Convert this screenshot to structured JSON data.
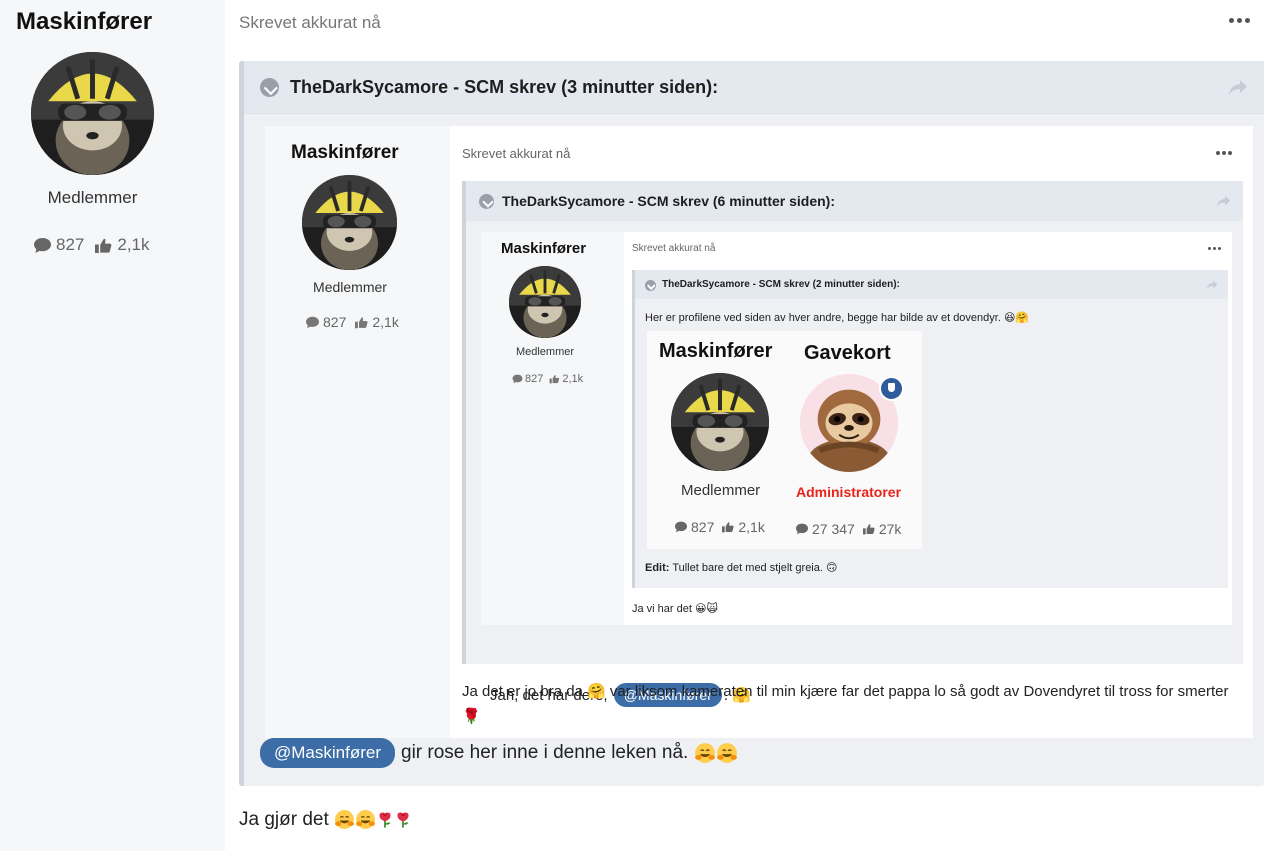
{
  "author": {
    "name": "Maskinfører",
    "group": "Medlemmer",
    "posts": "827",
    "reactions": "2,1k"
  },
  "post": {
    "date": "Skrevet akkurat nå",
    "body": "Ja gjør det",
    "body_emojis": [
      "hugging-face",
      "hugging-face",
      "rose",
      "rose"
    ]
  },
  "quote1": {
    "title": "TheDarkSycamore - SCM skrev (3 minutter siden):",
    "mention": "@Maskinfører",
    "text": "gir rose her inne i denne leken nå.",
    "emojis": [
      "hugging-face",
      "hugging-face"
    ],
    "embedded": {
      "author": {
        "name": "Maskinfører",
        "group": "Medlemmer",
        "posts": "827",
        "reactions": "2,1k"
      },
      "date": "Skrevet akkurat nå",
      "body": "Ja det er jo bra da 🤗 var liksom kameraten til min kjære far det pappa lo så godt av Dovendyret til tross for smerter 🌹",
      "quote2": {
        "title": "TheDarkSycamore - SCM skrev (6 minutter siden):",
        "reply_prefix": "Jah, det har dere,",
        "reply_mention": "@Maskinfører",
        "reply_suffix": ". 🤗",
        "embedded": {
          "author": {
            "name": "Maskinfører",
            "group": "Medlemmer",
            "posts": "827",
            "reactions": "2,1k"
          },
          "date": "Skrevet akkurat nå",
          "reply": "Ja vi har det 😀🙀",
          "quote3": {
            "title": "TheDarkSycamore - SCM skrev (2 minutter siden):",
            "text": "Her er profilene ved siden av hver andre, begge har bilde av et dovendyr. 😆🤗",
            "card": {
              "left": {
                "name": "Maskinfører",
                "group": "Medlemmer",
                "posts": "827",
                "reactions": "2,1k"
              },
              "right": {
                "name": "Gavekort",
                "group": "Administratorer",
                "posts": "27 347",
                "reactions": "27k"
              }
            },
            "edit_label": "Edit:",
            "edit_text": "Tullet bare det med stjelt greia. 🙃"
          }
        }
      }
    }
  },
  "icons": [
    "comment-icon",
    "thumbs-up-icon",
    "share-icon",
    "toggle-quote-icon",
    "more-options-icon",
    "moderator-badge-icon"
  ],
  "colors": {
    "mention": "#3d6da6",
    "admin": "#e8231a",
    "quote_bg": "#eef0f4",
    "sidebar_bg": "#f6f7f9"
  }
}
